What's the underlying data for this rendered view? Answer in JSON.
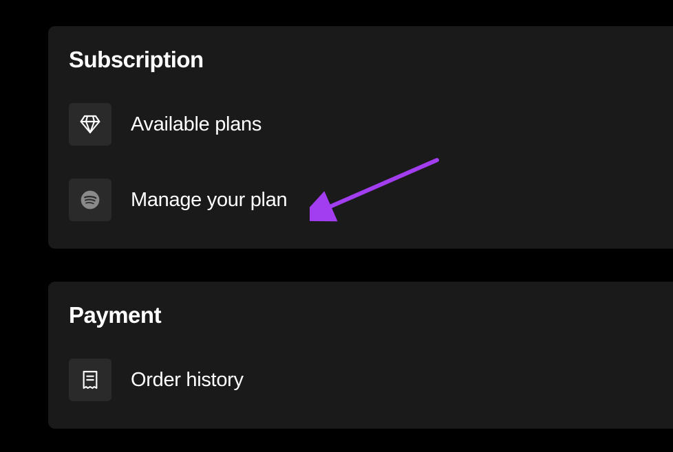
{
  "subscription": {
    "title": "Subscription",
    "items": [
      {
        "label": "Available plans",
        "icon": "diamond-icon"
      },
      {
        "label": "Manage your plan",
        "icon": "spotify-icon"
      }
    ]
  },
  "payment": {
    "title": "Payment",
    "items": [
      {
        "label": "Order history",
        "icon": "receipt-icon"
      }
    ]
  },
  "annotation": {
    "arrowColor": "#a23ef0"
  }
}
